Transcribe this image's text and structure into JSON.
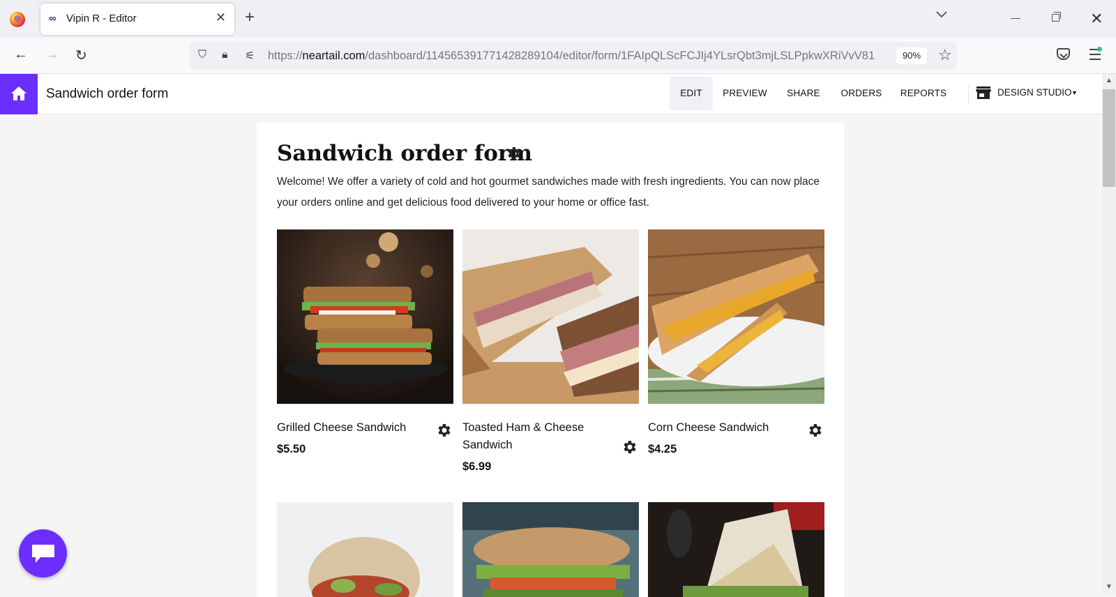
{
  "browser": {
    "tab_title": "Vipin R - Editor",
    "tab_icon": "∞",
    "url_prefix": "https://",
    "url_domain": "neartail.com",
    "url_path": "/dashboard/114565391771428289104/editor/form/1FAIpQLScFCJIj4YLsrQbt3mjLSLPpkwXRiVvV81",
    "zoom": "90%"
  },
  "app": {
    "title": "Sandwich order form",
    "nav": [
      {
        "label": "EDIT",
        "active": true
      },
      {
        "label": "PREVIEW",
        "active": false
      },
      {
        "label": "SHARE",
        "active": false
      },
      {
        "label": "ORDERS",
        "active": false
      },
      {
        "label": "REPORTS",
        "active": false
      }
    ],
    "design_studio": "DESIGN STUDIO",
    "accent": "#6c2dff"
  },
  "form": {
    "title": "Sandwich order form",
    "description": "Welcome! We offer a variety of cold and hot gourmet sandwiches made with fresh ingredients. You can now place your orders online and get delicious food delivered to your home or office fast.",
    "products": [
      {
        "name": "Grilled Cheese Sandwich",
        "price": "$5.50"
      },
      {
        "name": "Toasted Ham & Cheese Sandwich",
        "price": "$6.99"
      },
      {
        "name": "Corn Cheese Sandwich",
        "price": "$4.25"
      }
    ]
  }
}
